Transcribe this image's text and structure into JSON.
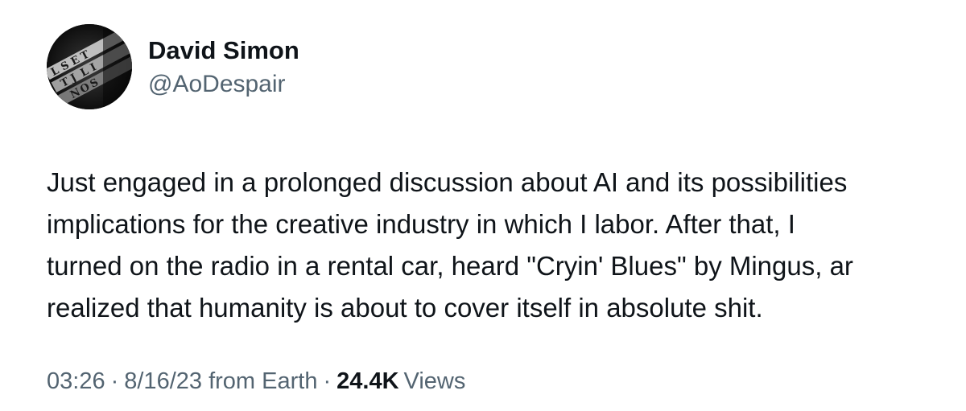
{
  "author": {
    "display_name": "David Simon",
    "handle": "@AoDespair"
  },
  "tweet": {
    "lines": [
      "Just engaged in a prolonged discussion about AI and its possibilities",
      "implications for the creative industry in which I labor. After that, I",
      "turned on the radio in a rental car, heard \"Cryin' Blues\" by Mingus, ar",
      "realized that humanity is about to cover itself in absolute shit."
    ]
  },
  "meta": {
    "time": "03:26",
    "separator": "·",
    "date": "8/16/23",
    "source": "from Earth",
    "views_count": "24.4K",
    "views_label": "Views"
  },
  "icons": {
    "avatar": "typewriter-keys-avatar"
  },
  "colors": {
    "text_primary": "#0f1419",
    "text_secondary": "#536471",
    "background": "#ffffff"
  }
}
